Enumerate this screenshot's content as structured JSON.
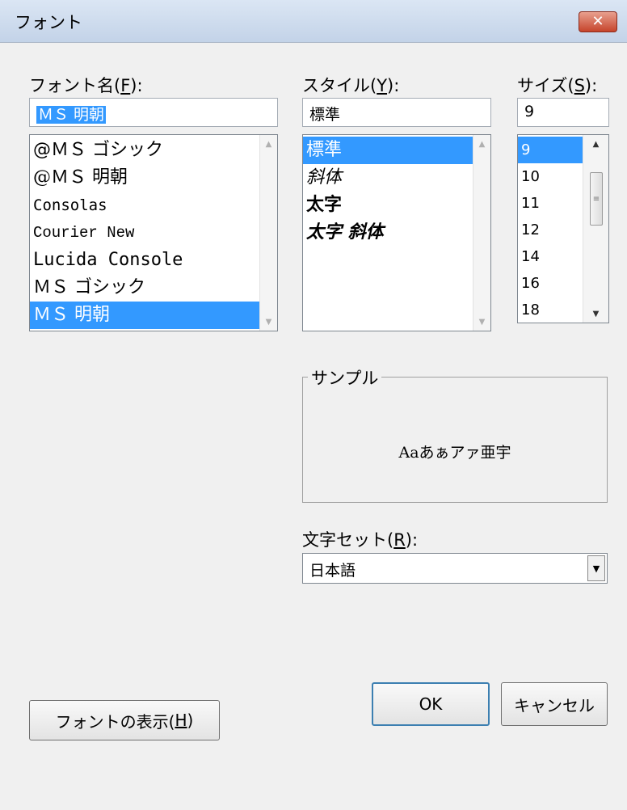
{
  "window": {
    "title": "フォント",
    "close_label": "✕"
  },
  "font_name": {
    "label_prefix": "フォント名(",
    "label_key": "F",
    "label_suffix": "):",
    "value": "ＭＳ 明朝",
    "items": [
      "@ＭＳ ゴシック",
      "@ＭＳ 明朝",
      "Consolas",
      "Courier New",
      "Lucida Console",
      "ＭＳ ゴシック",
      "ＭＳ 明朝"
    ],
    "selected": "ＭＳ 明朝"
  },
  "style": {
    "label_prefix": "スタイル(",
    "label_key": "Y",
    "label_suffix": "):",
    "value": "標準",
    "items": [
      "標準",
      "斜体",
      "太字",
      "太字 斜体"
    ],
    "selected": "標準"
  },
  "size": {
    "label_prefix": "サイズ(",
    "label_key": "S",
    "label_suffix": "):",
    "value": "9",
    "items": [
      "9",
      "10",
      "11",
      "12",
      "14",
      "16",
      "18"
    ],
    "selected": "9"
  },
  "sample": {
    "legend": "サンプル",
    "text": "Aaあぁアァ亜宇"
  },
  "charset": {
    "label_prefix": "文字セット(",
    "label_key": "R",
    "label_suffix": "):",
    "value": "日本語"
  },
  "buttons": {
    "show_fonts_prefix": "フォントの表示(",
    "show_fonts_key": "H",
    "show_fonts_suffix": ")",
    "ok": "OK",
    "cancel": "キャンセル"
  },
  "icons": {
    "close": "close-icon",
    "scroll_up": "scroll-up-arrow-icon",
    "scroll_down": "scroll-down-arrow-icon",
    "dropdown": "chevron-down-icon"
  },
  "colors": {
    "selection": "#3399ff",
    "dialog_bg": "#f0f0f0",
    "close_button": "#c6442c"
  }
}
